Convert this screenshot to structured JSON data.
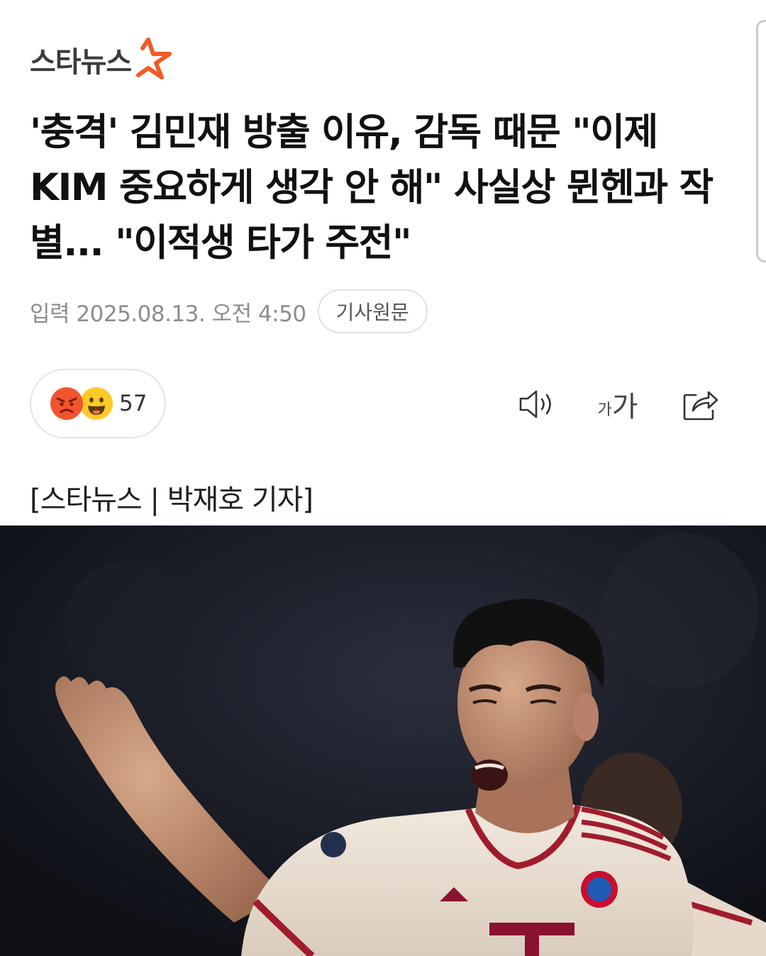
{
  "brand": {
    "name": "스타뉴스",
    "accent": "#f15a24"
  },
  "article": {
    "headline": "'충격' 김민재 방출 이유, 감독 때문 \"이제 KIM 중요하게 생각 안 해\" 사실상 뮌헨과 작별... \"이적생 타가 주전\"",
    "published": "입력 2025.08.13. 오전 4:50",
    "source_button": "기사원문",
    "byline": "[스타뉴스 | 박재호 기자]"
  },
  "reactions": {
    "count": "57",
    "emojis": [
      "angry-emoji",
      "happy-emoji"
    ]
  },
  "toolbar": {
    "font_small": "가",
    "font_large": "가",
    "icons": [
      "speaker-icon",
      "font-size-icon",
      "share-icon"
    ]
  },
  "photo": {
    "jersey_color": "#eee3d6",
    "trim_color": "#a01c2c"
  }
}
